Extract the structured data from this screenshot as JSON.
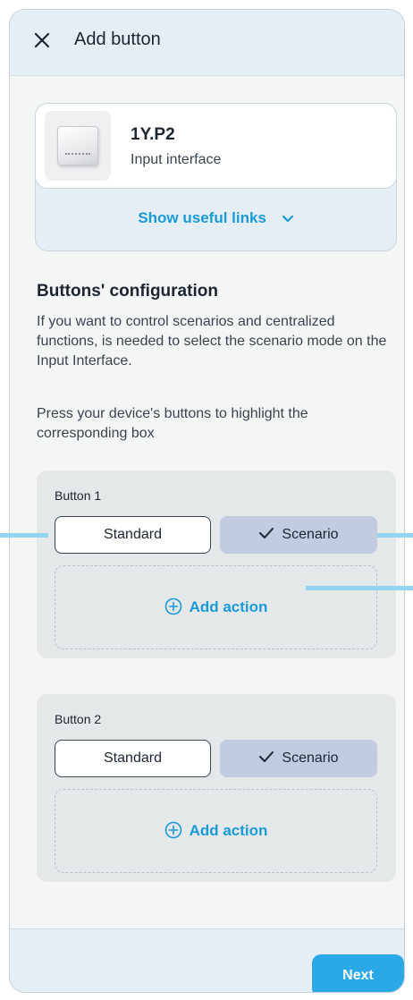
{
  "header": {
    "title": "Add button"
  },
  "device": {
    "model": "1Y.P2",
    "type": "Input interface",
    "links_label": "Show useful links"
  },
  "configuration": {
    "title": "Buttons' configuration",
    "description": "If you want to control scenarios and centralized functions, is needed to select the scenario mode on the Input Interface.",
    "instruction": "Press your device's buttons to highlight the corresponding box"
  },
  "buttons": [
    {
      "label": "Button 1",
      "standard_label": "Standard",
      "scenario_label": "Scenario",
      "selected": "Scenario",
      "add_action_label": "Add action"
    },
    {
      "label": "Button 2",
      "standard_label": "Standard",
      "scenario_label": "Scenario",
      "selected": "Scenario",
      "add_action_label": "Add action"
    }
  ],
  "footer": {
    "next_label": "Next"
  },
  "colors": {
    "accent": "#1a9bd8",
    "primary_button": "#2ba8e6",
    "selected_segment": "#c2cbe0",
    "header_bg": "#e4eef4",
    "callout": "#93d4f0"
  },
  "icons": [
    "close-icon",
    "chevron-down-icon",
    "check-icon",
    "plus-circle-icon"
  ]
}
